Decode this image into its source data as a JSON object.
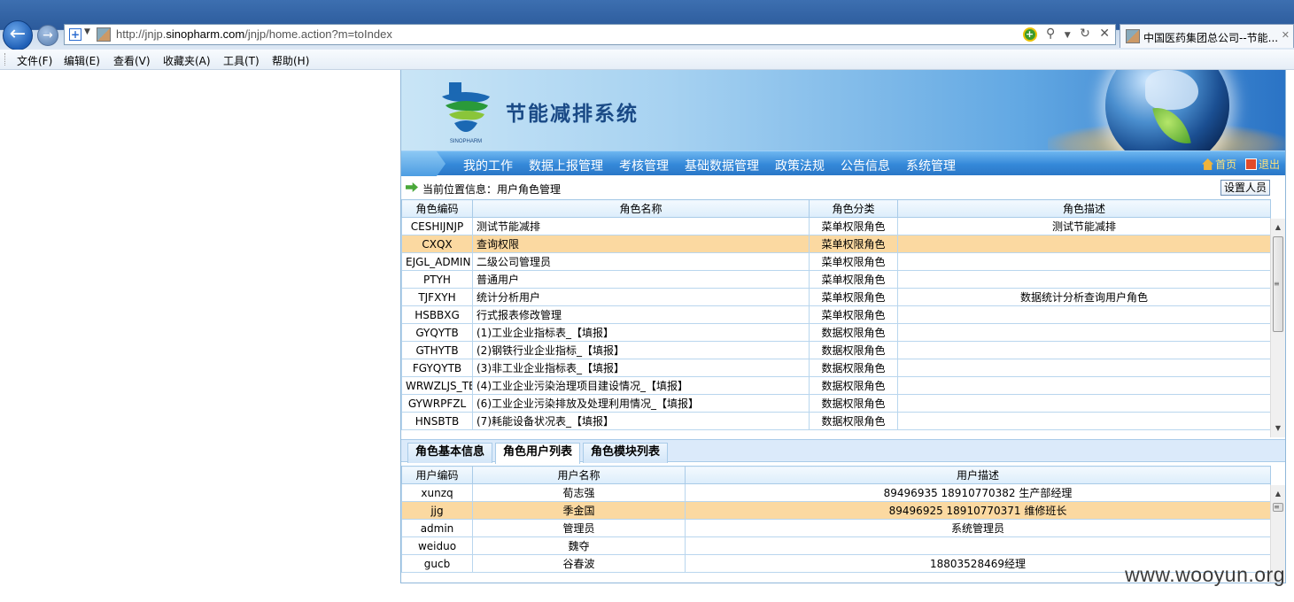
{
  "browser": {
    "url_prefix": "http://jnjp.",
    "url_domain": "sinopharm.com",
    "url_path": "/jnjp/home.action?m=toIndex",
    "tab_title": "中国医药集团总公司--节能...",
    "menu": [
      "文件(F)",
      "编辑(E)",
      "查看(V)",
      "收藏夹(A)",
      "工具(T)",
      "帮助(H)"
    ]
  },
  "app": {
    "title": "节能减排系统",
    "logo_text": "SINOPHARM",
    "nav": [
      "我的工作",
      "数据上报管理",
      "考核管理",
      "基础数据管理",
      "政策法规",
      "公告信息",
      "系统管理"
    ],
    "nav_home": "首页",
    "nav_exit": "退出",
    "location": "当前位置信息：用户角色管理",
    "setup_button": "设置人员"
  },
  "roles": {
    "headers": [
      "角色编码",
      "角色名称",
      "角色分类",
      "角色描述"
    ],
    "rows": [
      {
        "code": "CESHIJNJP",
        "name": "测试节能减排",
        "type": "菜单权限角色",
        "desc": "测试节能减排"
      },
      {
        "code": "CXQX",
        "name": "查询权限",
        "type": "菜单权限角色",
        "desc": ""
      },
      {
        "code": "EJGL_ADMIN",
        "name": "二级公司管理员",
        "type": "菜单权限角色",
        "desc": ""
      },
      {
        "code": "PTYH",
        "name": "普通用户",
        "type": "菜单权限角色",
        "desc": ""
      },
      {
        "code": "TJFXYH",
        "name": "统计分析用户",
        "type": "菜单权限角色",
        "desc": "数据统计分析查询用户角色"
      },
      {
        "code": "HSBBXG",
        "name": "行式报表修改管理",
        "type": "菜单权限角色",
        "desc": ""
      },
      {
        "code": "GYQYTB",
        "name": "(1)工业企业指标表_【填报】",
        "type": "数据权限角色",
        "desc": ""
      },
      {
        "code": "GTHYTB",
        "name": "(2)钢铁行业企业指标_【填报】",
        "type": "数据权限角色",
        "desc": ""
      },
      {
        "code": "FGYQYTB",
        "name": "(3)非工业企业指标表_【填报】",
        "type": "数据权限角色",
        "desc": ""
      },
      {
        "code": "WRWZLJS_TB",
        "name": "(4)工业企业污染治理项目建设情况_【填报】",
        "type": "数据权限角色",
        "desc": ""
      },
      {
        "code": "GYWRPFZL",
        "name": "(6)工业企业污染排放及处理利用情况_【填报】",
        "type": "数据权限角色",
        "desc": ""
      },
      {
        "code": "HNSBTB",
        "name": "(7)耗能设备状况表_【填报】",
        "type": "数据权限角色",
        "desc": ""
      }
    ],
    "selected_row_index": 1
  },
  "tabs": [
    "角色基本信息",
    "角色用户列表",
    "角色模块列表"
  ],
  "active_tab_index": 1,
  "users": {
    "headers": [
      "用户编码",
      "用户名称",
      "用户描述"
    ],
    "rows": [
      {
        "code": "xunzq",
        "name": "荀志强",
        "desc": "89496935 18910770382 生产部经理"
      },
      {
        "code": "jjg",
        "name": "季金国",
        "desc": "89496925 18910770371 维修班长"
      },
      {
        "code": "admin",
        "name": "管理员",
        "desc": "系统管理员"
      },
      {
        "code": "weiduo",
        "name": "魏夺",
        "desc": ""
      },
      {
        "code": "gucb",
        "name": "谷春波",
        "desc": "18803528469经理"
      }
    ],
    "selected_row_index": 1
  },
  "watermark": "www.wooyun.org"
}
